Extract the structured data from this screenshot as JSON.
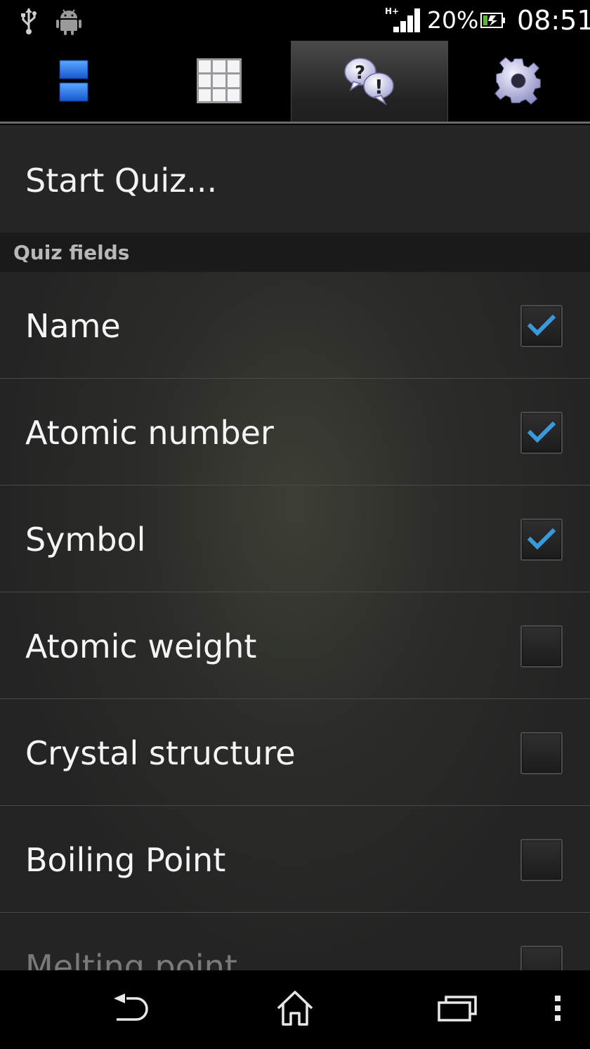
{
  "status_bar": {
    "network_type": "H+",
    "battery_percent": "20%",
    "time": "08:51"
  },
  "tabs": [
    {
      "id": "list",
      "icon": "list-view-icon",
      "active": false
    },
    {
      "id": "grid",
      "icon": "grid-view-icon",
      "active": false
    },
    {
      "id": "quiz",
      "icon": "quiz-bubbles-icon",
      "active": true
    },
    {
      "id": "settings",
      "icon": "gear-icon",
      "active": false
    }
  ],
  "start_quiz": {
    "label": "Start Quiz..."
  },
  "quiz_fields": {
    "header": "Quiz fields",
    "items": [
      {
        "label": "Name",
        "checked": true
      },
      {
        "label": "Atomic number",
        "checked": true
      },
      {
        "label": "Symbol",
        "checked": true
      },
      {
        "label": "Atomic weight",
        "checked": false
      },
      {
        "label": "Crystal structure",
        "checked": false
      },
      {
        "label": "Boiling Point",
        "checked": false
      },
      {
        "label": "Melting point",
        "checked": false
      }
    ]
  },
  "colors": {
    "checkmark": "#3a9ad9",
    "tab_icon_blue": "#1f6fe0",
    "background": "#242424"
  },
  "nav_bar": {
    "icons": [
      "back-icon",
      "home-icon",
      "recents-icon",
      "menu-icon"
    ]
  }
}
